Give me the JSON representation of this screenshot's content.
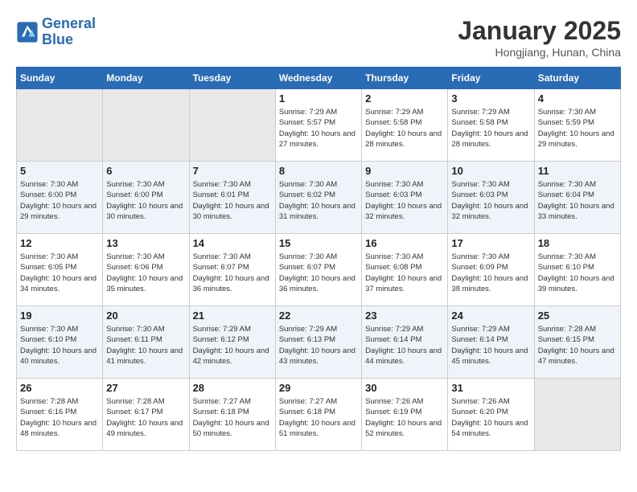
{
  "logo": {
    "line1": "General",
    "line2": "Blue"
  },
  "title": "January 2025",
  "subtitle": "Hongjiang, Hunan, China",
  "weekdays": [
    "Sunday",
    "Monday",
    "Tuesday",
    "Wednesday",
    "Thursday",
    "Friday",
    "Saturday"
  ],
  "weeks": [
    [
      {
        "day": "",
        "info": ""
      },
      {
        "day": "",
        "info": ""
      },
      {
        "day": "",
        "info": ""
      },
      {
        "day": "1",
        "info": "Sunrise: 7:29 AM\nSunset: 5:57 PM\nDaylight: 10 hours\nand 27 minutes."
      },
      {
        "day": "2",
        "info": "Sunrise: 7:29 AM\nSunset: 5:58 PM\nDaylight: 10 hours\nand 28 minutes."
      },
      {
        "day": "3",
        "info": "Sunrise: 7:29 AM\nSunset: 5:58 PM\nDaylight: 10 hours\nand 28 minutes."
      },
      {
        "day": "4",
        "info": "Sunrise: 7:30 AM\nSunset: 5:59 PM\nDaylight: 10 hours\nand 29 minutes."
      }
    ],
    [
      {
        "day": "5",
        "info": "Sunrise: 7:30 AM\nSunset: 6:00 PM\nDaylight: 10 hours\nand 29 minutes."
      },
      {
        "day": "6",
        "info": "Sunrise: 7:30 AM\nSunset: 6:00 PM\nDaylight: 10 hours\nand 30 minutes."
      },
      {
        "day": "7",
        "info": "Sunrise: 7:30 AM\nSunset: 6:01 PM\nDaylight: 10 hours\nand 30 minutes."
      },
      {
        "day": "8",
        "info": "Sunrise: 7:30 AM\nSunset: 6:02 PM\nDaylight: 10 hours\nand 31 minutes."
      },
      {
        "day": "9",
        "info": "Sunrise: 7:30 AM\nSunset: 6:03 PM\nDaylight: 10 hours\nand 32 minutes."
      },
      {
        "day": "10",
        "info": "Sunrise: 7:30 AM\nSunset: 6:03 PM\nDaylight: 10 hours\nand 32 minutes."
      },
      {
        "day": "11",
        "info": "Sunrise: 7:30 AM\nSunset: 6:04 PM\nDaylight: 10 hours\nand 33 minutes."
      }
    ],
    [
      {
        "day": "12",
        "info": "Sunrise: 7:30 AM\nSunset: 6:05 PM\nDaylight: 10 hours\nand 34 minutes."
      },
      {
        "day": "13",
        "info": "Sunrise: 7:30 AM\nSunset: 6:06 PM\nDaylight: 10 hours\nand 35 minutes."
      },
      {
        "day": "14",
        "info": "Sunrise: 7:30 AM\nSunset: 6:07 PM\nDaylight: 10 hours\nand 36 minutes."
      },
      {
        "day": "15",
        "info": "Sunrise: 7:30 AM\nSunset: 6:07 PM\nDaylight: 10 hours\nand 36 minutes."
      },
      {
        "day": "16",
        "info": "Sunrise: 7:30 AM\nSunset: 6:08 PM\nDaylight: 10 hours\nand 37 minutes."
      },
      {
        "day": "17",
        "info": "Sunrise: 7:30 AM\nSunset: 6:09 PM\nDaylight: 10 hours\nand 38 minutes."
      },
      {
        "day": "18",
        "info": "Sunrise: 7:30 AM\nSunset: 6:10 PM\nDaylight: 10 hours\nand 39 minutes."
      }
    ],
    [
      {
        "day": "19",
        "info": "Sunrise: 7:30 AM\nSunset: 6:10 PM\nDaylight: 10 hours\nand 40 minutes."
      },
      {
        "day": "20",
        "info": "Sunrise: 7:30 AM\nSunset: 6:11 PM\nDaylight: 10 hours\nand 41 minutes."
      },
      {
        "day": "21",
        "info": "Sunrise: 7:29 AM\nSunset: 6:12 PM\nDaylight: 10 hours\nand 42 minutes."
      },
      {
        "day": "22",
        "info": "Sunrise: 7:29 AM\nSunset: 6:13 PM\nDaylight: 10 hours\nand 43 minutes."
      },
      {
        "day": "23",
        "info": "Sunrise: 7:29 AM\nSunset: 6:14 PM\nDaylight: 10 hours\nand 44 minutes."
      },
      {
        "day": "24",
        "info": "Sunrise: 7:29 AM\nSunset: 6:14 PM\nDaylight: 10 hours\nand 45 minutes."
      },
      {
        "day": "25",
        "info": "Sunrise: 7:28 AM\nSunset: 6:15 PM\nDaylight: 10 hours\nand 47 minutes."
      }
    ],
    [
      {
        "day": "26",
        "info": "Sunrise: 7:28 AM\nSunset: 6:16 PM\nDaylight: 10 hours\nand 48 minutes."
      },
      {
        "day": "27",
        "info": "Sunrise: 7:28 AM\nSunset: 6:17 PM\nDaylight: 10 hours\nand 49 minutes."
      },
      {
        "day": "28",
        "info": "Sunrise: 7:27 AM\nSunset: 6:18 PM\nDaylight: 10 hours\nand 50 minutes."
      },
      {
        "day": "29",
        "info": "Sunrise: 7:27 AM\nSunset: 6:18 PM\nDaylight: 10 hours\nand 51 minutes."
      },
      {
        "day": "30",
        "info": "Sunrise: 7:26 AM\nSunset: 6:19 PM\nDaylight: 10 hours\nand 52 minutes."
      },
      {
        "day": "31",
        "info": "Sunrise: 7:26 AM\nSunset: 6:20 PM\nDaylight: 10 hours\nand 54 minutes."
      },
      {
        "day": "",
        "info": ""
      }
    ]
  ]
}
